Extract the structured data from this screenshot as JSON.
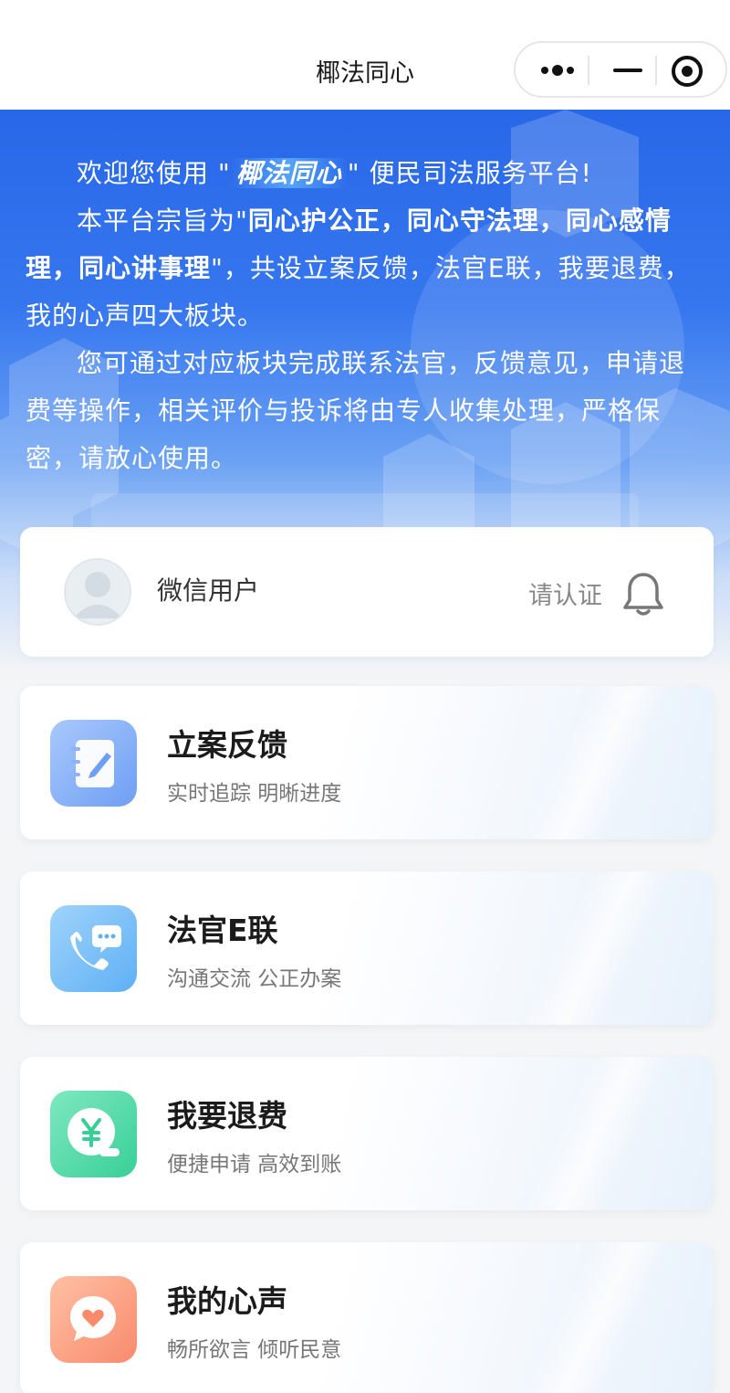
{
  "app": {
    "title": "椰法同心"
  },
  "capsule": {
    "more_icon": "more-dots-icon",
    "minimize_icon": "minimize-icon",
    "close_icon": "target-circle-icon"
  },
  "intro": {
    "p1_prefix": "欢迎您使用 \"",
    "p1_brand": "椰法同心",
    "p1_suffix": "\" 便民司法服务平台!",
    "p2_prefix": "本平台宗旨为\"",
    "p2_motto": "同心护公正，同心守法理，同心感情理，同心讲事理",
    "p2_suffix": "\"，共设立案反馈，法官E联，我要退费，我的心声四大板块。",
    "p3": "您可通过对应板块完成联系法官，反馈意见，申请退费等操作，相关评价与投诉将由专人收集处理，严格保密，请放心使用。"
  },
  "user": {
    "name": "微信用户",
    "verify_label": "请认证",
    "avatar_icon": "avatar-icon",
    "bell_icon": "bell-icon"
  },
  "modules": [
    {
      "title": "立案反馈",
      "subtitle": "实时追踪 明晰进度",
      "icon": "notebook-pen-icon",
      "color": "#7aa8f7"
    },
    {
      "title": "法官E联",
      "subtitle": "沟通交流 公正办案",
      "icon": "phone-chat-icon",
      "color": "#6cb6f7"
    },
    {
      "title": "我要退费",
      "subtitle": "便捷申请 高效到账",
      "icon": "yuan-refund-icon",
      "color": "#4fd8a6"
    },
    {
      "title": "我的心声",
      "subtitle": "畅所欲言 倾听民意",
      "icon": "heart-chat-icon",
      "color": "#fb9a7c"
    }
  ]
}
